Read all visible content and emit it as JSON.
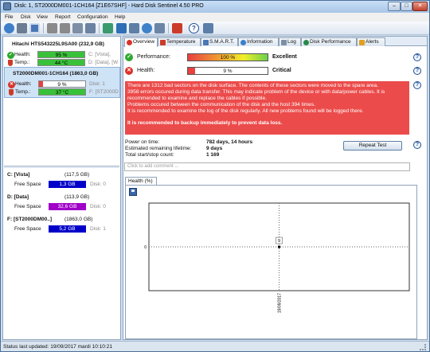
{
  "window": {
    "title": "Disk: 1, ST2000DM001-1CH164 [Z1E67SHF]  -  Hard Disk Sentinel 4.50 PRO",
    "minimize": "–",
    "maximize": "□",
    "close": "✕"
  },
  "menu": [
    "File",
    "Disk",
    "View",
    "Report",
    "Configuration",
    "Help"
  ],
  "toolbar": {
    "icons": [
      "refresh-icon",
      "disk-icon",
      "monitor-icon",
      "tools-icon",
      "tools-2-icon",
      "settings-icon",
      "report-icon",
      "test-icon",
      "surface-icon",
      "update-icon",
      "sync-icon",
      "mail-icon",
      "help-icon",
      "info-icon"
    ]
  },
  "disks": [
    {
      "name": "Hitachi HTS543225L9SA00 (232,9 GB)",
      "health_label": "Health:",
      "health": "95 %",
      "health_pct": 95,
      "health_color": "#2ea82e",
      "temp_label": "Temp.:",
      "temp": "44 °C",
      "temp_color": "#2ea82e",
      "info1": "C: [Vista],",
      "info2": "D: [Data],",
      "info2b": "[W",
      "status": "ok"
    },
    {
      "name": "ST2000DM001-1CH164 (1863,0 GB)",
      "health_label": "Health:",
      "health": "9 %",
      "health_pct": 9,
      "health_color": "#e84040",
      "temp_label": "Temp.:",
      "temp": "37 °C",
      "temp_color": "#2ea82e",
      "info1": "Disk: 1",
      "info2": "F: [ST2000D",
      "status": "bad"
    }
  ],
  "volumes": [
    {
      "name": "C: [Vista]",
      "size": "(117,5 GB)",
      "free_label": "Free Space",
      "free": "1,3 GB",
      "bar_color": "#0000c8",
      "disk": "Disk: 0"
    },
    {
      "name": "D: [Data]",
      "size": "(113,9 GB)",
      "free_label": "Free Space",
      "free": "32,6 GB",
      "bar_color": "#a000c8",
      "disk": "Disk: 0"
    },
    {
      "name": "F: [ST2000DM00..]",
      "size": "(1863,0 GB)",
      "free_label": "Free Space",
      "free": "5,2 GB",
      "bar_color": "#0000c8",
      "disk": "Disk: 1"
    }
  ],
  "tabs": [
    {
      "label": "Overview",
      "icon": "overview-icon",
      "active": true
    },
    {
      "label": "Temperature",
      "icon": "temperature-icon",
      "active": false
    },
    {
      "label": "S.M.A.R.T.",
      "icon": "smart-icon",
      "active": false
    },
    {
      "label": "Information",
      "icon": "information-icon",
      "active": false
    },
    {
      "label": "Log",
      "icon": "log-icon",
      "active": false
    },
    {
      "label": "Disk Performance",
      "icon": "disk-performance-icon",
      "active": false
    },
    {
      "label": "Alerts",
      "icon": "alerts-icon",
      "active": false
    }
  ],
  "overview": {
    "performance_label": "Performance:",
    "performance_value": "100 %",
    "performance_pct": 100,
    "performance_status": "Excellent",
    "health_label": "Health:",
    "health_value": "9 %",
    "health_pct": 9,
    "health_status": "Critical",
    "help": "?",
    "alert_lines": [
      "There are 1312 bad sectors on the disk surface. The contents of these sectors were moved to the spare area.",
      "3958 errors occured during data transfer. This may indicate problem of the device or with data/power cables. It is recommended to examine and replace the cables if possible.",
      "Problems occured between the communication of the disk and the host 394 times.",
      "It is recommended to examine the log of the disk regularly. All new problems found will be logged there."
    ],
    "alert_strong": "It is recommended to backup immediately to prevent data loss.",
    "power_on_label": "Power on time:",
    "power_on_value": "782 days, 14 hours",
    "remaining_label": "Estimated remaining lifetime:",
    "remaining_value": "9 days",
    "start_stop_label": "Total start/stop count:",
    "start_stop_value": "1 169",
    "repeat_test": "Repeat Test",
    "comment_placeholder": "Click to add comment ..."
  },
  "chart_tab": "Health (%)",
  "chart_data": {
    "type": "line",
    "x": [
      "19/09/2017"
    ],
    "values": [
      9
    ],
    "y_tick_labels": [
      "0"
    ],
    "point_label": "9",
    "grid": true
  },
  "status": "Status last updated: 19/09/2017 mardi 10:10:21",
  "colors": {
    "perf_bar": "#f2f02a",
    "health_bar": "#e84040",
    "alert_bg": "#ec4b4b"
  }
}
